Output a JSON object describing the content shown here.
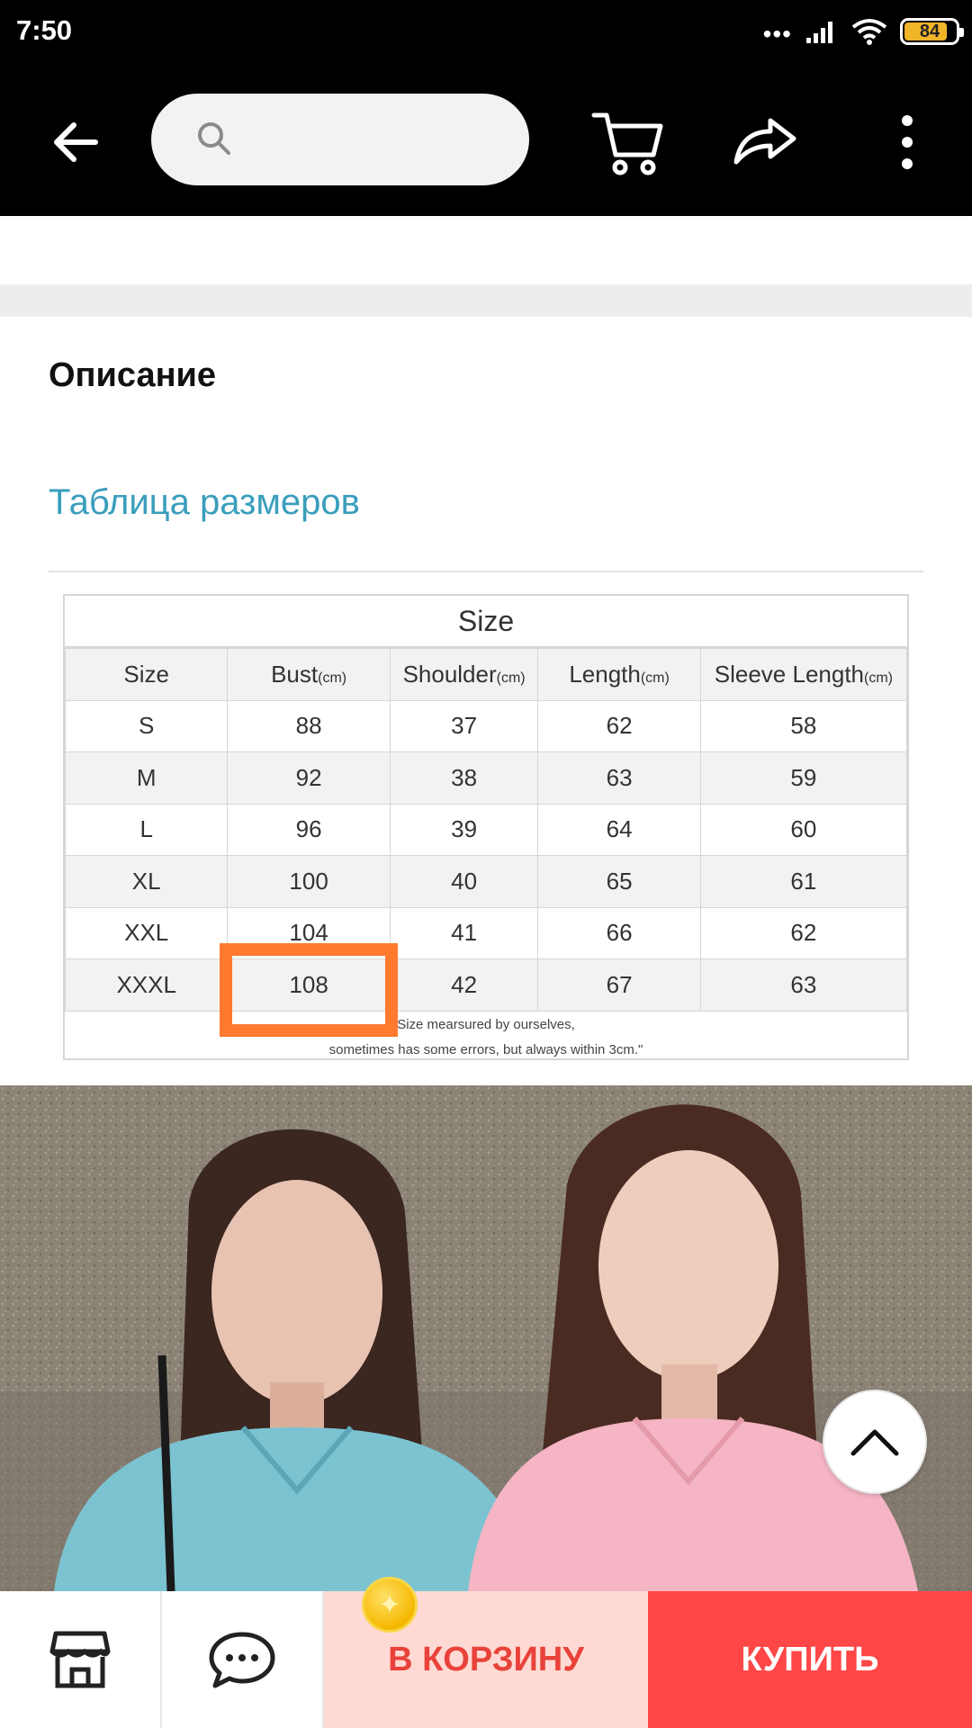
{
  "status_bar": {
    "time": "7:50",
    "signal_dots": "•••",
    "battery_level": "84"
  },
  "header": {
    "search": {
      "placeholder": ""
    },
    "icons": [
      "back-arrow-icon",
      "search-icon",
      "cart-icon",
      "share-icon",
      "more-vertical-icon"
    ]
  },
  "description": {
    "title": "Описание",
    "size_table_link": "Таблица размеров"
  },
  "size_chart": {
    "title": "Size",
    "headers": [
      {
        "label": "Size",
        "unit": ""
      },
      {
        "label": "Bust",
        "unit": "(cm)"
      },
      {
        "label": "Shoulder",
        "unit": "(cm)"
      },
      {
        "label": "Length",
        "unit": "(cm)"
      },
      {
        "label": "Sleeve Length",
        "unit": "(cm)"
      }
    ],
    "rows": [
      [
        "S",
        "88",
        "37",
        "62",
        "58"
      ],
      [
        "M",
        "92",
        "38",
        "63",
        "59"
      ],
      [
        "L",
        "96",
        "39",
        "64",
        "60"
      ],
      [
        "XL",
        "100",
        "40",
        "65",
        "61"
      ],
      [
        "XXL",
        "104",
        "41",
        "66",
        "62"
      ],
      [
        "XXXL",
        "108",
        "42",
        "67",
        "63"
      ]
    ],
    "note_line1": "Size mearsured by ourselves,",
    "note_line2": "sometimes has some errors, but always within 3cm.\"",
    "highlighted_cell": "108"
  },
  "bottom_bar": {
    "add_to_cart": "В КОРЗИНУ",
    "buy": "КУПИТЬ",
    "icons": [
      "store-icon",
      "chat-icon",
      "coin-icon"
    ]
  },
  "colors": {
    "link": "#3a9ebc",
    "highlight": "#ff7a2e",
    "cart_bg": "#ffd9d3",
    "cart_text": "#e8423a",
    "buy_bg": "#ff4747"
  }
}
